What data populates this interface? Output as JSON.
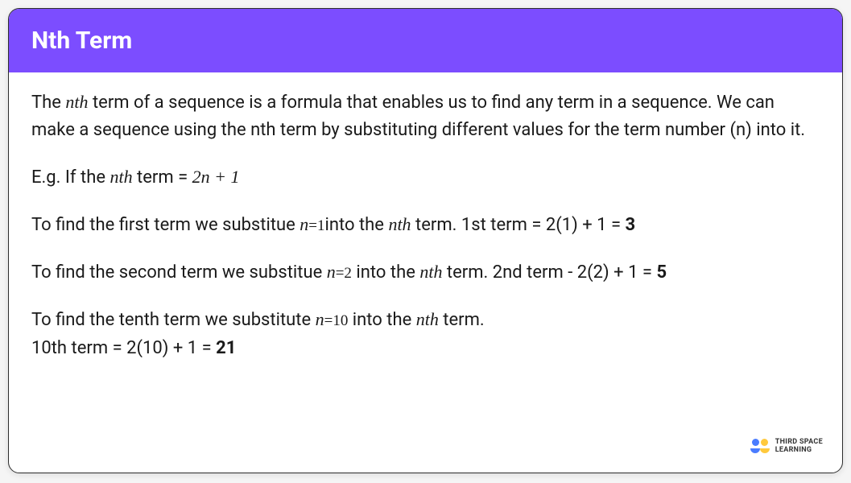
{
  "header": {
    "title": "Nth Term"
  },
  "content": {
    "p1_a": "The ",
    "p1_nth": "nth",
    "p1_b": " term of a sequence is a formula that enables us to find any term in a sequence. We can make a sequence using the nth term by substituting different values for the term number (n) into it.",
    "p2_a": "E.g. If the ",
    "p2_nth": "nth",
    "p2_b": " term = ",
    "p2_formula": "2n + 1",
    "p3_a": "To find the first term we substitue  ",
    "p3_sub": "n=1",
    "p3_b": "into the ",
    "p3_nth": "nth",
    "p3_c": " term. 1st term = 2(1) + 1 = ",
    "p3_ans": "3",
    "p4_a": "To find the second term we substitue ",
    "p4_sub": "n=2",
    "p4_b": " into the ",
    "p4_nth": "nth",
    "p4_c": " term. 2nd term - 2(2) + 1 = ",
    "p4_ans": "5",
    "p5_a": "To find the tenth term we substitute ",
    "p5_sub": "n=10",
    "p5_b": " into the ",
    "p5_nth": "nth",
    "p5_c": " term.",
    "p5_d": "10th term = 2(10) + 1 = ",
    "p5_ans": "21"
  },
  "logo": {
    "line1": "THIRD SPACE",
    "line2": "LEARNING"
  }
}
